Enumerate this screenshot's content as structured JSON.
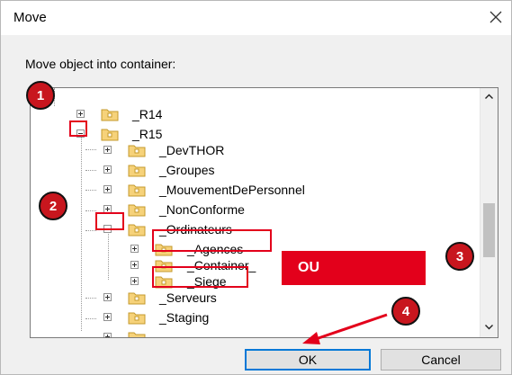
{
  "dialog": {
    "title": "Move",
    "prompt": "Move object into container:"
  },
  "tree": {
    "items": [
      {
        "label": "_R14",
        "expander": "plus"
      },
      {
        "label": "_R15",
        "expander": "minus"
      },
      {
        "label": "_DevTHOR",
        "expander": "plus"
      },
      {
        "label": "_Groupes",
        "expander": "plus"
      },
      {
        "label": "_MouvementDePersonnel",
        "expander": "plus"
      },
      {
        "label": "_NonConforme",
        "expander": "plus"
      },
      {
        "label": "_Ordinateurs",
        "expander": "minus"
      },
      {
        "label": "_Agences",
        "expander": "plus"
      },
      {
        "label": "_Container_",
        "expander": "plus"
      },
      {
        "label": "_Siege",
        "expander": "plus"
      },
      {
        "label": "_Serveurs",
        "expander": "plus"
      },
      {
        "label": "_Staging",
        "expander": "plus"
      }
    ]
  },
  "buttons": {
    "ok": "OK",
    "cancel": "Cancel"
  },
  "annotations": {
    "badges": [
      "1",
      "2",
      "3",
      "4"
    ],
    "ou_label": "OU",
    "color": "#e3001b"
  }
}
